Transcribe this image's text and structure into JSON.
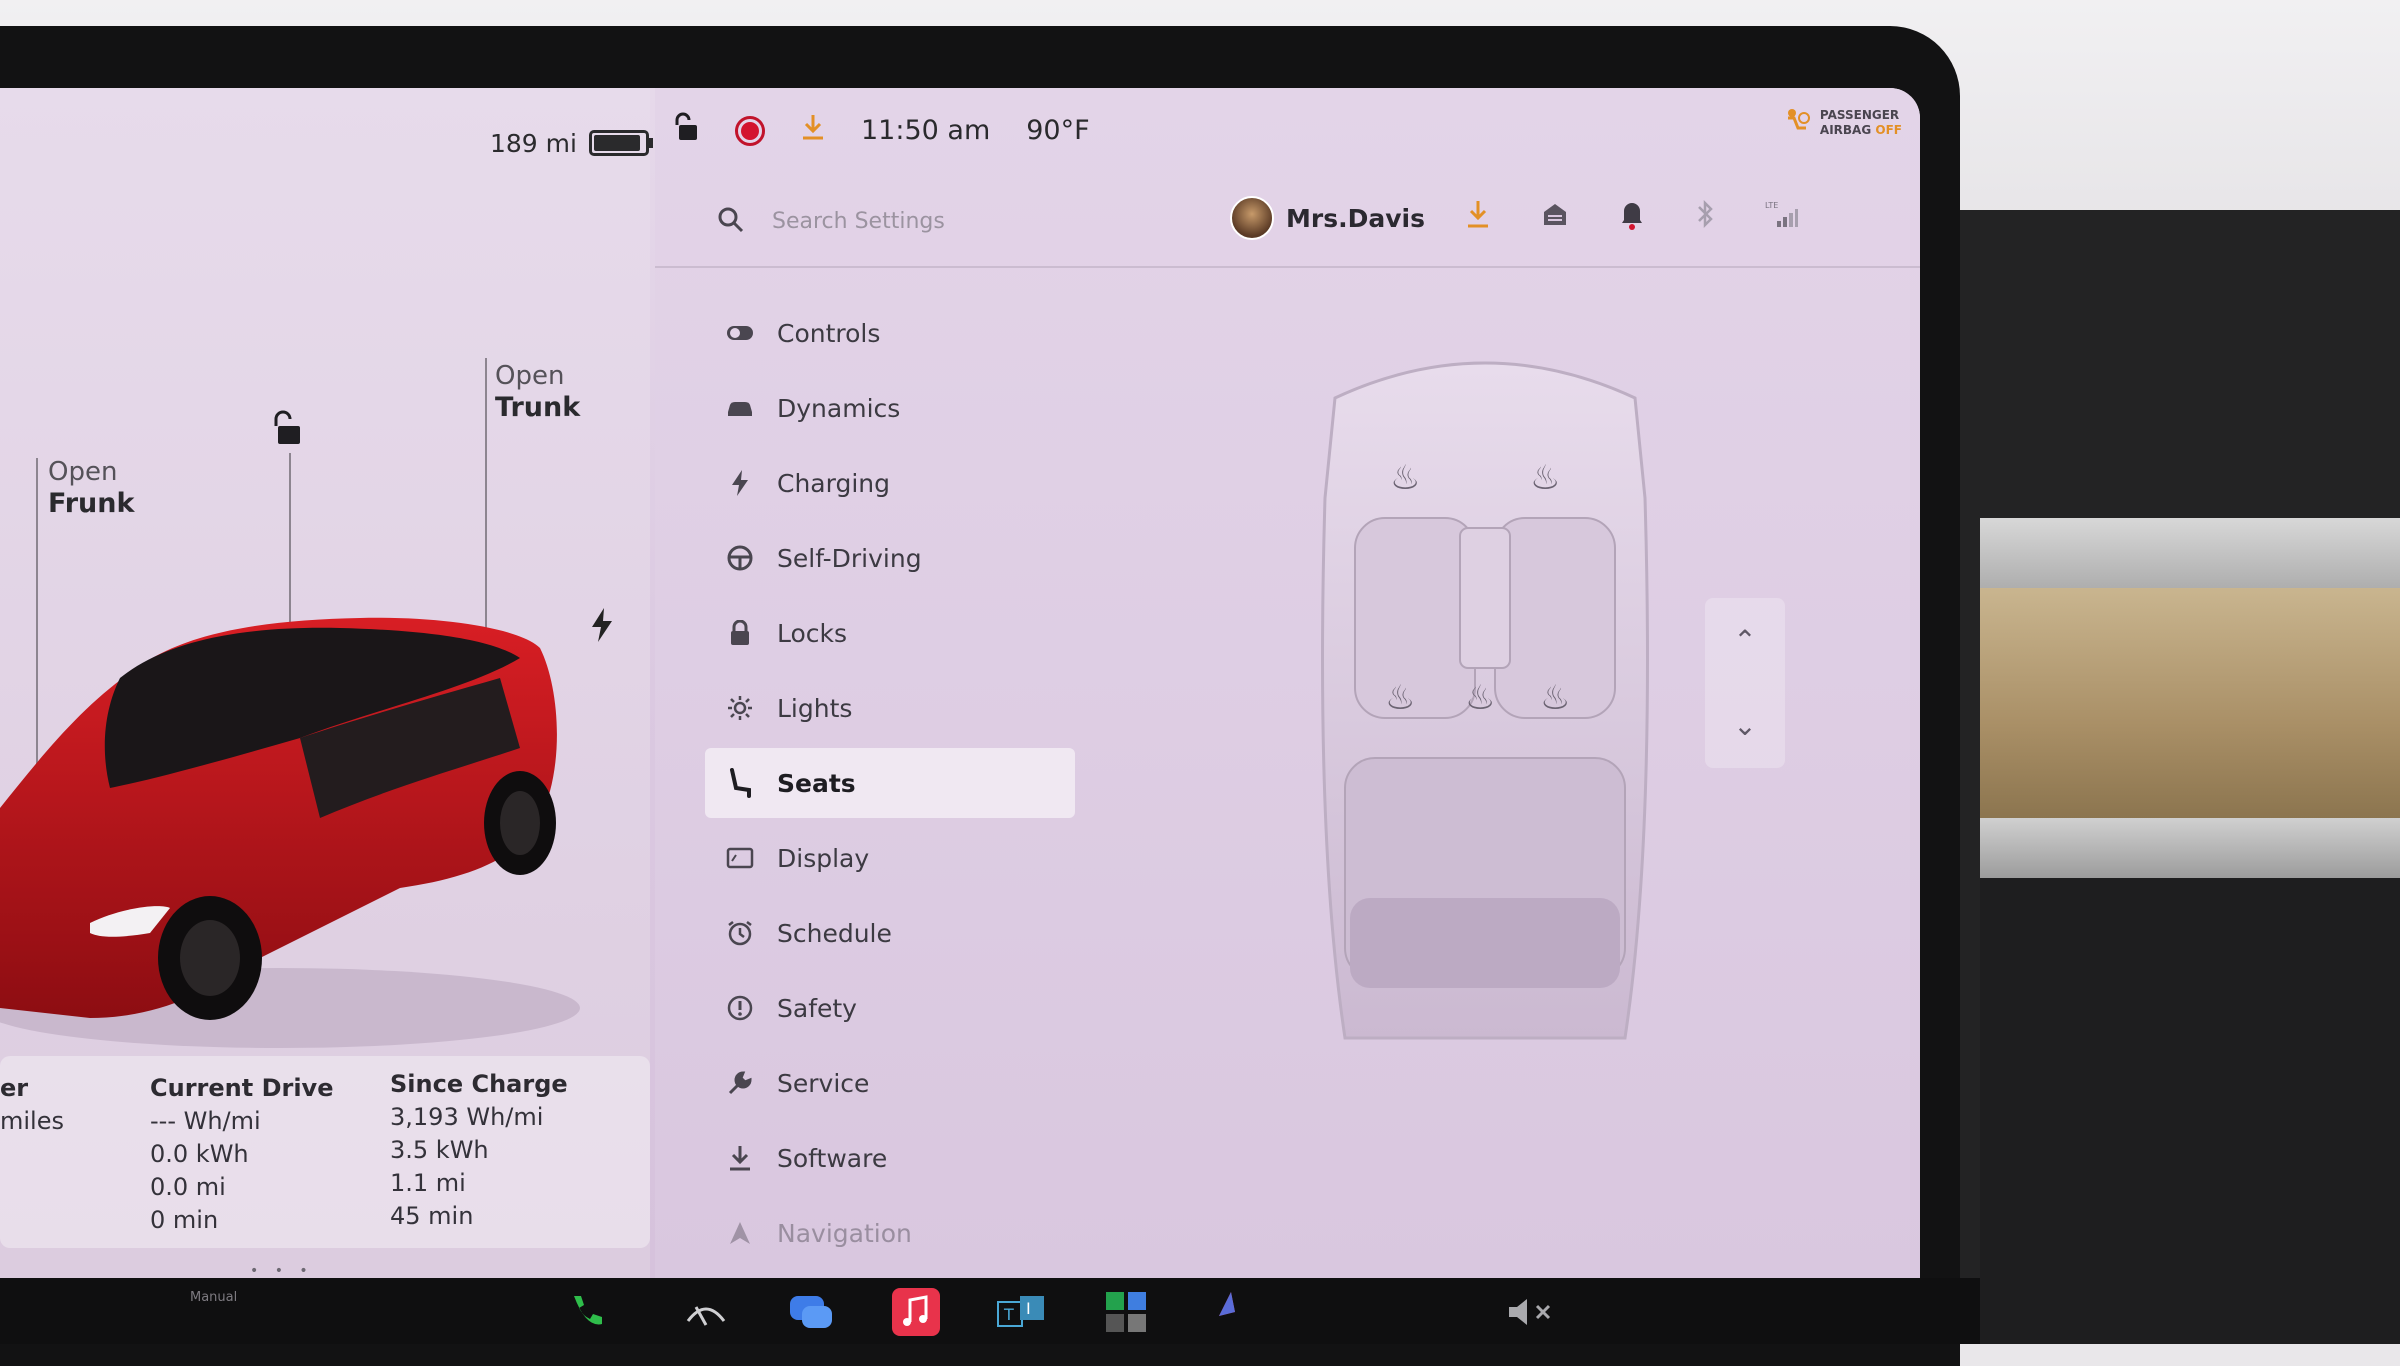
{
  "status": {
    "range": "189 mi",
    "battery_level": 0.85,
    "time": "11:50 am",
    "temperature": "90°F"
  },
  "airbag": {
    "line1": "PASSENGER",
    "line2": "AIRBAG",
    "state": "OFF"
  },
  "car": {
    "frunk_top": "Open",
    "frunk_bottom": "Frunk",
    "trunk_top": "Open",
    "trunk_bottom": "Trunk"
  },
  "stats": {
    "partial_col": {
      "header": "er",
      "line1": "miles"
    },
    "current_drive": {
      "header": "Current Drive",
      "efficiency": "--- Wh/mi",
      "energy": "0.0 kWh",
      "distance": "0.0 mi",
      "time": "0 min"
    },
    "since_charge": {
      "header": "Since Charge",
      "efficiency": "3,193 Wh/mi",
      "energy": "3.5 kWh",
      "distance": "1.1 mi",
      "time": "45 min"
    }
  },
  "search": {
    "placeholder": "Search Settings"
  },
  "user": {
    "name": "Mrs.Davis"
  },
  "menu": [
    {
      "label": "Controls",
      "icon": "toggle-icon"
    },
    {
      "label": "Dynamics",
      "icon": "car-icon"
    },
    {
      "label": "Charging",
      "icon": "bolt-icon"
    },
    {
      "label": "Self-Driving",
      "icon": "steering-wheel-icon"
    },
    {
      "label": "Locks",
      "icon": "lock-icon"
    },
    {
      "label": "Lights",
      "icon": "sun-icon"
    },
    {
      "label": "Seats",
      "icon": "seat-icon"
    },
    {
      "label": "Display",
      "icon": "display-icon"
    },
    {
      "label": "Schedule",
      "icon": "alarm-icon"
    },
    {
      "label": "Safety",
      "icon": "info-circle-icon"
    },
    {
      "label": "Service",
      "icon": "wrench-icon"
    },
    {
      "label": "Software",
      "icon": "download-icon"
    },
    {
      "label": "Navigation",
      "icon": "navigation-icon"
    }
  ],
  "dock": {
    "manual_label": "Manual"
  },
  "colors": {
    "accent_orange": "#e39026",
    "record_red": "#d3142f",
    "car_red": "#c4161c"
  }
}
